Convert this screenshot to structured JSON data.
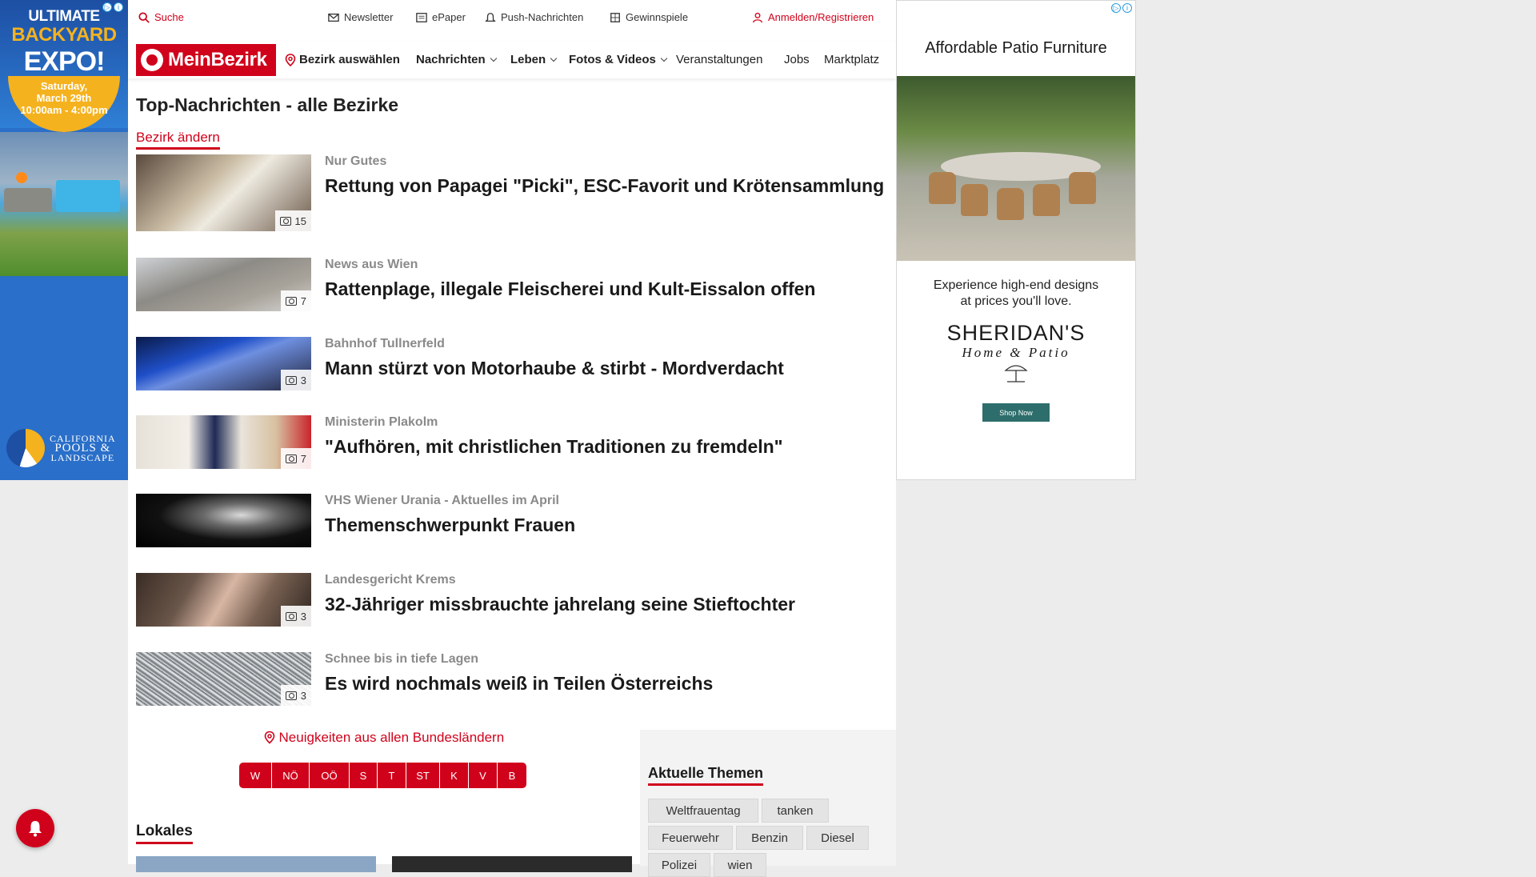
{
  "ad_left": {
    "headline_1": "ULTIMATE",
    "headline_2": "BACKYARD",
    "headline_3": "EXPO!",
    "date_line_1": "Saturday,",
    "date_line_2": "March 29th",
    "date_line_3": "10:00am - 4:00pm",
    "logo_line_1": "CALIFORNIA",
    "logo_line_2": "POOLS &",
    "logo_line_3": "LANDSCAPE"
  },
  "topbar": {
    "search": "Suche",
    "newsletter": "Newsletter",
    "epaper": "ePaper",
    "push": "Push-Nachrichten",
    "contests": "Gewinnspiele",
    "login": "Anmelden/Registrieren"
  },
  "navbar": {
    "brand": "MeinBezirk",
    "select_district": "Bezirk auswählen",
    "items": [
      {
        "label": "Nachrichten"
      },
      {
        "label": "Leben"
      },
      {
        "label": "Fotos & Videos"
      },
      {
        "label": "Veranstaltungen"
      },
      {
        "label": "Jobs"
      },
      {
        "label": "Marktplatz"
      }
    ]
  },
  "main": {
    "title": "Top-Nachrichten - alle Bezirke",
    "change_district": "Bezirk ändern",
    "articles": [
      {
        "kicker": "Nur Gutes",
        "headline": "Rettung von Papagei \"Picki\", ESC-Favorit und Krötensammlung",
        "photos": "15"
      },
      {
        "kicker": "News aus Wien",
        "headline": "Rattenplage, illegale Fleischerei und Kult-Eissalon offen",
        "photos": "7"
      },
      {
        "kicker": "Bahnhof Tullnerfeld",
        "headline": "Mann stürzt von Motorhaube & stirbt - Mordverdacht",
        "photos": "3"
      },
      {
        "kicker": "Ministerin Plakolm",
        "headline": "\"Aufhören, mit christlichen Traditionen zu fremdeln\"",
        "photos": "7"
      },
      {
        "kicker": "VHS Wiener Urania - Aktuelles im April",
        "headline": "Themenschwerpunkt Frauen",
        "photos": ""
      },
      {
        "kicker": "Landesgericht Krems",
        "headline": "32-Jähriger missbrauchte jahrelang seine Stieftochter",
        "photos": "3"
      },
      {
        "kicker": "Schnee bis in tiefe Lagen",
        "headline": "Es wird nochmals weiß in Teilen Österreichs",
        "photos": "3"
      }
    ],
    "bundeslaender_link": "Neuigkeiten aus allen Bundesländern",
    "states": [
      "W",
      "NÖ",
      "OÖ",
      "S",
      "T",
      "ST",
      "K",
      "V",
      "B"
    ],
    "lokales": "Lokales"
  },
  "themen": {
    "title": "Aktuelle Themen",
    "chips": [
      "Weltfrauentag",
      "tanken",
      "Feuerwehr",
      "Benzin",
      "Diesel",
      "Polizei",
      "wien"
    ]
  },
  "ad_right": {
    "title": "Affordable Patio Furniture",
    "pitch_line_1": "Experience high-end designs",
    "pitch_line_2": "at prices you'll love.",
    "brand": "SHERIDAN'S",
    "brand_sub": "Home & Patio",
    "cta": "Shop Now"
  },
  "colors": {
    "brand_red": "#d0021b",
    "ad_teal": "#2d6e6c",
    "ad_blue": "#2a6fc9"
  }
}
